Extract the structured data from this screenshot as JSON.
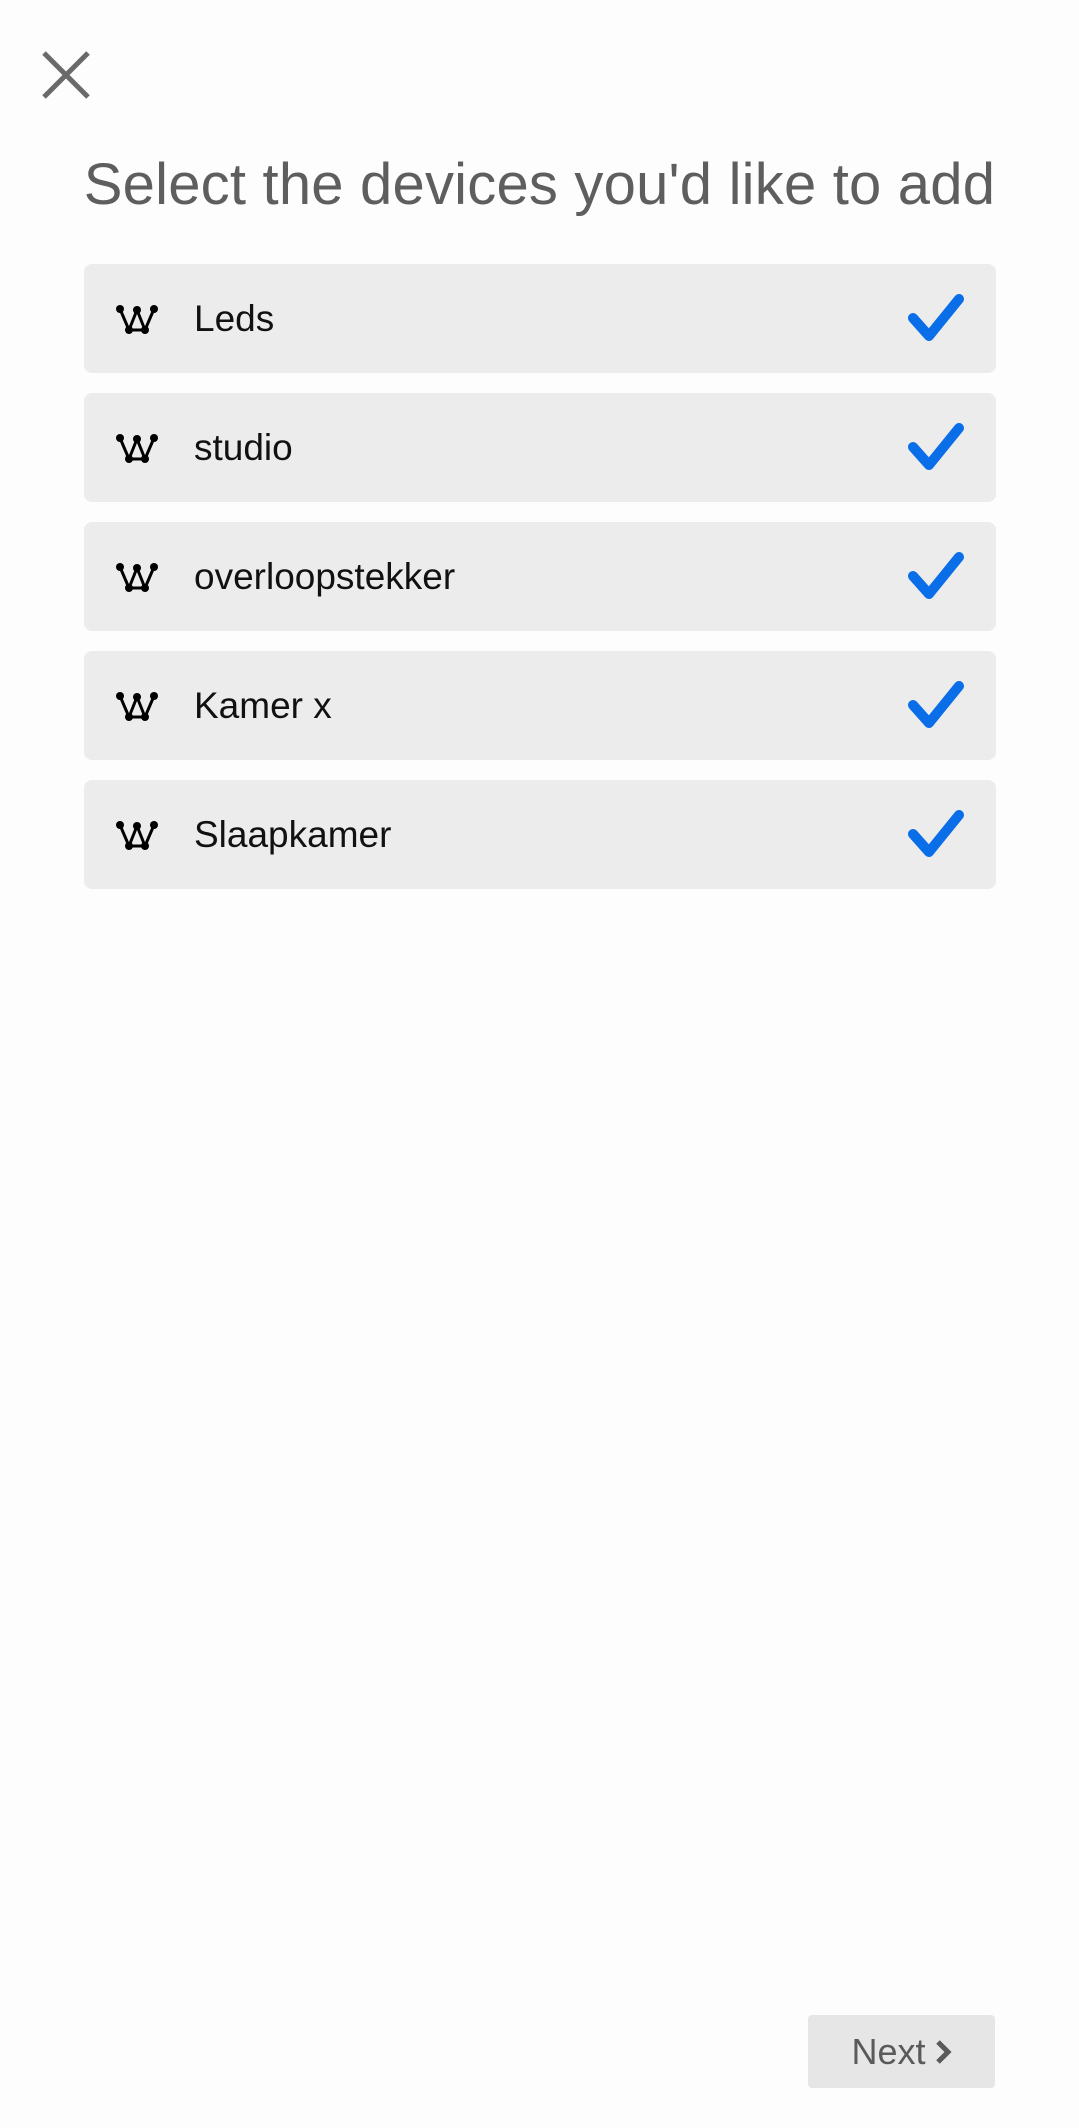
{
  "header": {
    "close_icon": "close-icon",
    "title": "Select the devices you'd like to add"
  },
  "devices": [
    {
      "label": "Leds",
      "icon": "device-network-icon",
      "selected": true
    },
    {
      "label": "studio",
      "icon": "device-network-icon",
      "selected": true
    },
    {
      "label": "overloopstekker",
      "icon": "device-network-icon",
      "selected": true
    },
    {
      "label": "Kamer x",
      "icon": "device-network-icon",
      "selected": true
    },
    {
      "label": "Slaapkamer",
      "icon": "device-network-icon",
      "selected": true
    }
  ],
  "footer": {
    "next_label": "Next",
    "next_icon": "chevron-right-icon"
  },
  "colors": {
    "accent": "#0a6ee8",
    "item_background": "#ececec",
    "title_text": "#5e5e5e",
    "button_background": "#e6e6e6"
  }
}
